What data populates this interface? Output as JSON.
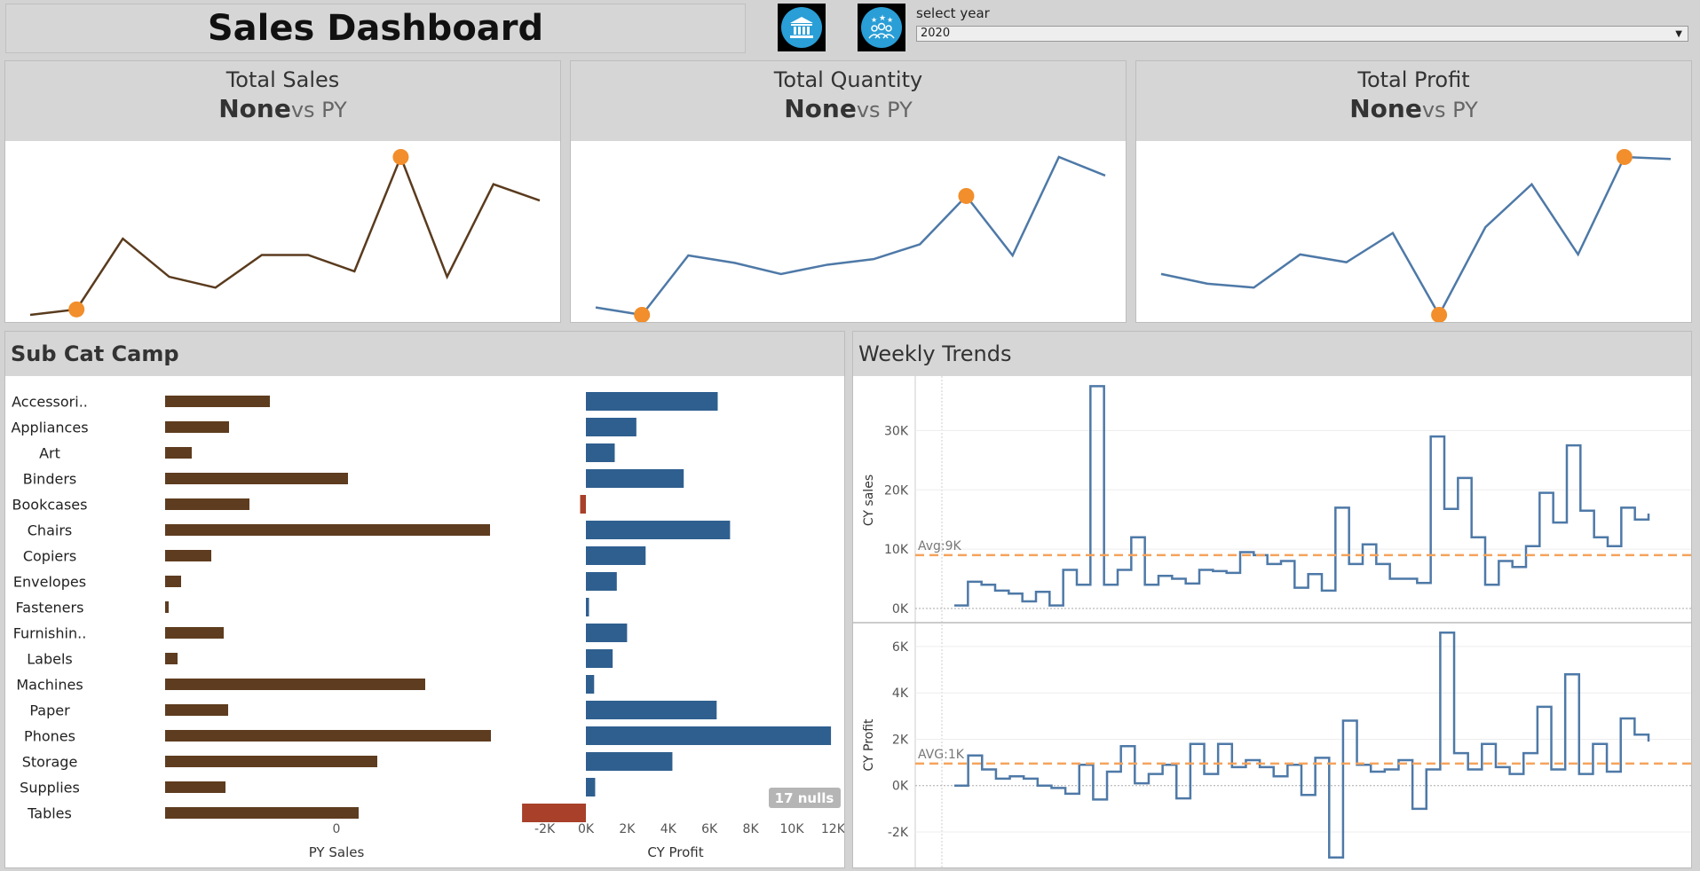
{
  "header": {
    "title": "Sales Dashboard",
    "icons": [
      "bank-icon",
      "team-awards-icon"
    ],
    "filter_label": "select year",
    "filter_value": "2020"
  },
  "kpis": [
    {
      "title": "Total Sales",
      "value": "None",
      "suffix": "vs PY",
      "color": "#5a3b1e",
      "values": [
        29,
        30,
        43,
        36,
        34,
        40,
        40,
        37,
        58,
        36,
        53,
        50
      ],
      "max_index": 8,
      "min_index": 1
    },
    {
      "title": "Total Quantity",
      "value": "None",
      "suffix": "vs PY",
      "color": "#4e79a7",
      "values": [
        22,
        18,
        50,
        46,
        40,
        45,
        48,
        56,
        82,
        50,
        103,
        93
      ],
      "max_index": 8,
      "min_index": 1
    },
    {
      "title": "Total Profit",
      "value": "None",
      "suffix": "vs PY",
      "color": "#4e79a7",
      "values": [
        25,
        20,
        18,
        35,
        31,
        46,
        4,
        49,
        71,
        35,
        85,
        84
      ],
      "max_index": 10,
      "min_index": 6
    }
  ],
  "subcat": {
    "title": "Sub Cat Camp",
    "nulls_badge": "17 nulls",
    "py_label": "PY Sales",
    "py_tick": "0",
    "cy_label": "CY Profit",
    "colors": {
      "py": "#5e3c1f",
      "pos": "#2f5f8f",
      "neg": "#a8402a"
    },
    "categories": [
      "Accessori..",
      "Appliances",
      "Art",
      "Binders",
      "Bookcases",
      "Chairs",
      "Copiers",
      "Envelopes",
      "Fasteners",
      "Furnishin..",
      "Labels",
      "Machines",
      "Paper",
      "Phones",
      "Storage",
      "Supplies",
      "Tables"
    ],
    "py_sales": [
      118,
      72,
      30,
      206,
      95,
      366,
      52,
      18,
      4,
      66,
      14,
      293,
      71,
      367,
      239,
      68,
      218
    ],
    "cy_profit": [
      6400,
      2450,
      1400,
      4750,
      -280,
      7000,
      2900,
      1500,
      150,
      2000,
      1300,
      400,
      6350,
      11900,
      4200,
      450,
      -3100
    ],
    "cy_ticks": [
      "-2K",
      "0K",
      "2K",
      "4K",
      "6K",
      "8K",
      "10K",
      "12K"
    ],
    "cy_tick_values": [
      -2000,
      0,
      2000,
      4000,
      6000,
      8000,
      10000,
      12000
    ]
  },
  "weekly": {
    "title": "Weekly Trends",
    "line_color": "#4e79a7",
    "avg_color": "#f5a35c",
    "sales": {
      "ylabel": "CY sales",
      "avg_label": "Avg:9K",
      "avg": 9000,
      "ticks": [
        "0K",
        "10K",
        "20K",
        "30K"
      ],
      "tick_values": [
        0,
        10000,
        20000,
        30000
      ],
      "ylim": [
        -1500,
        38000
      ],
      "values": [
        500,
        4500,
        4000,
        3000,
        2500,
        1200,
        2800,
        500,
        6500,
        4000,
        37500,
        4000,
        6500,
        12000,
        4000,
        5500,
        5000,
        4200,
        6500,
        6300,
        6000,
        9500,
        9000,
        7500,
        8000,
        3500,
        5800,
        3000,
        17000,
        7500,
        10800,
        7500,
        5000,
        5000,
        4300,
        29000,
        16800,
        22000,
        12000,
        4000,
        8000,
        7000,
        10500,
        19500,
        14500,
        27500,
        16500,
        12000,
        10500,
        17000,
        15000,
        16000
      ]
    },
    "profit": {
      "ylabel": "CY Profit",
      "avg_label": "AVG:1K",
      "avg": 950,
      "ticks": [
        "-2K",
        "0K",
        "2K",
        "4K",
        "6K"
      ],
      "tick_values": [
        -2000,
        0,
        2000,
        4000,
        6000
      ],
      "ylim": [
        -3300,
        6800
      ],
      "values": [
        0,
        1300,
        700,
        300,
        400,
        300,
        0,
        -100,
        -350,
        900,
        -600,
        600,
        1700,
        100,
        500,
        900,
        -550,
        1800,
        500,
        1800,
        800,
        1100,
        800,
        400,
        900,
        -400,
        1200,
        -3100,
        2800,
        900,
        600,
        700,
        1100,
        -1000,
        700,
        6600,
        1400,
        700,
        1800,
        800,
        500,
        1400,
        3400,
        700,
        4800,
        500,
        1800,
        600,
        2900,
        2200,
        1900
      ]
    }
  }
}
